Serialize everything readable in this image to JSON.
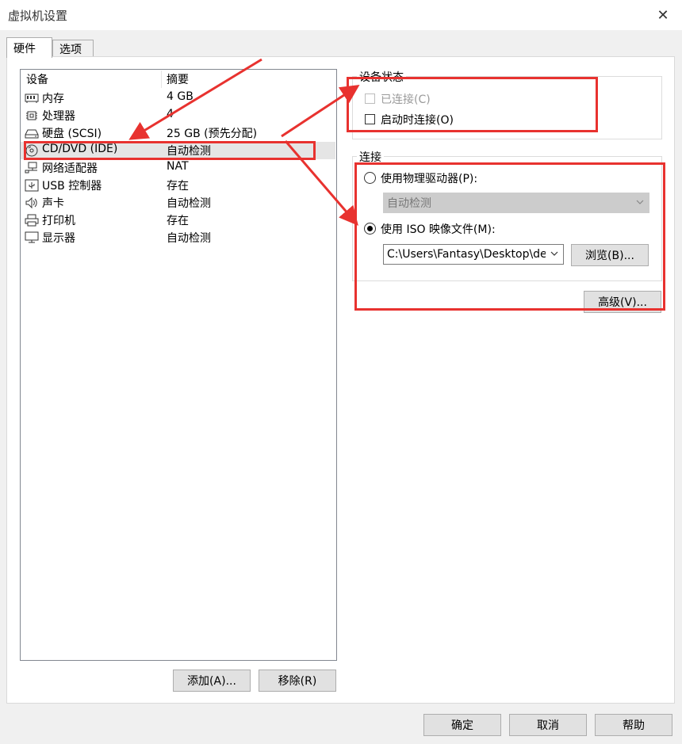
{
  "window": {
    "title": "虚拟机设置",
    "close_glyph": "✕"
  },
  "tabs": [
    {
      "label": "硬件",
      "active": true
    },
    {
      "label": "选项",
      "active": false
    }
  ],
  "device_list": {
    "headers": {
      "device": "设备",
      "summary": "摘要"
    },
    "rows": [
      {
        "name": "内存",
        "summary": "4 GB",
        "icon": "memory-icon"
      },
      {
        "name": "处理器",
        "summary": "4",
        "icon": "processor-icon"
      },
      {
        "name": "硬盘 (SCSI)",
        "summary": "25 GB (预先分配)",
        "icon": "hard-disk-icon"
      },
      {
        "name": "CD/DVD (IDE)",
        "summary": "自动检测",
        "icon": "cd-dvd-icon",
        "selected": true
      },
      {
        "name": "网络适配器",
        "summary": "NAT",
        "icon": "network-adapter-icon"
      },
      {
        "name": "USB 控制器",
        "summary": "存在",
        "icon": "usb-icon"
      },
      {
        "name": "声卡",
        "summary": "自动检测",
        "icon": "speaker-icon"
      },
      {
        "name": "打印机",
        "summary": "存在",
        "icon": "printer-icon"
      },
      {
        "name": "显示器",
        "summary": "自动检测",
        "icon": "monitor-icon"
      }
    ],
    "add_button": "添加(A)...",
    "remove_button": "移除(R)"
  },
  "device_status": {
    "title": "设备状态",
    "connected": {
      "label": "已连接(C)",
      "checked": false,
      "disabled": true
    },
    "connect_at_power_on": {
      "label": "启动时连接(O)",
      "checked": false
    }
  },
  "connection": {
    "title": "连接",
    "physical_drive": {
      "label": "使用物理驱动器(P):",
      "selected": false,
      "select_value": "自动检测"
    },
    "iso_image": {
      "label": "使用 ISO 映像文件(M):",
      "selected": true,
      "path": "C:\\Users\\Fantasy\\Desktop\\dee",
      "browse_button": "浏览(B)..."
    },
    "advanced_button": "高级(V)..."
  },
  "footer": {
    "ok": "确定",
    "cancel": "取消",
    "help": "帮助"
  },
  "annotation_color": "#e8322f"
}
